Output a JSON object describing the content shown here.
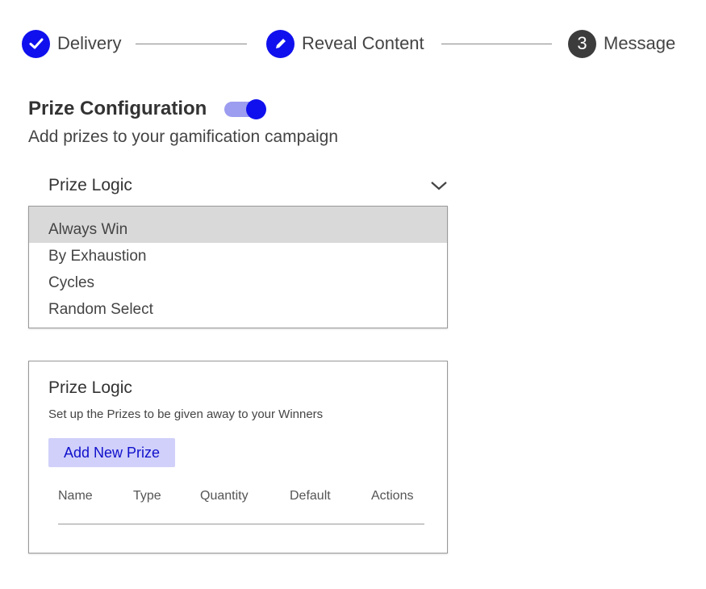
{
  "stepper": {
    "steps": [
      {
        "label": "Delivery",
        "state": "completed",
        "icon": "check-icon"
      },
      {
        "label": "Reveal Content",
        "state": "active",
        "icon": "pencil-icon"
      },
      {
        "label": "Message",
        "state": "pending",
        "number": "3"
      }
    ]
  },
  "config": {
    "title": "Prize Configuration",
    "toggle_on": true,
    "subtitle": "Add prizes to your gamification campaign"
  },
  "prize_logic_select": {
    "label": "Prize Logic",
    "options": [
      "Always Win",
      "By Exhaustion",
      "Cycles",
      "Random Select"
    ],
    "highlighted": "Always Win"
  },
  "prize_card": {
    "title": "Prize Logic",
    "subtitle": "Set up the Prizes to be given away to your Winners",
    "add_button": "Add New Prize",
    "columns": [
      "Name",
      "Type",
      "Quantity",
      "Default",
      "Actions"
    ]
  },
  "colors": {
    "accent": "#1010ee",
    "toggle_track": "#9c9cf0",
    "button_bg": "#d0d0fa"
  }
}
